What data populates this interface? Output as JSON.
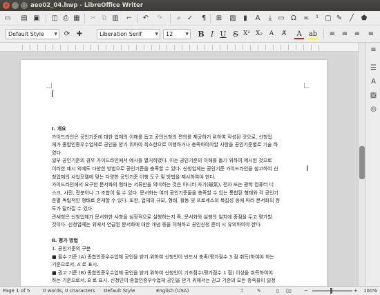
{
  "window": {
    "title": "aeo02_04.hwp - LibreOffice Writer"
  },
  "toolbar": {
    "paragraph_style": "Default Style",
    "font_name": "Liberation Serif",
    "font_size": "12"
  },
  "document": {
    "lines": [
      {
        "text": "Ⅰ. 개요",
        "heading": true
      },
      {
        "text": "  가이드라인은 공인기준에 대한 업체의 이해를 돕고 공인신청의 편의를 제공하기 위하여 작성된 것으로, 신청업",
        "heading": false
      },
      {
        "text": "체가 종합인증우수업체로 공인을 받기 위하여 최소한으로 이행하거나 충족하여야할 사항을 공인기준별로 기술 하",
        "heading": false
      },
      {
        "text": "였다.",
        "heading": false
      },
      {
        "text": "  일부 공인기준의 경우 가이드라인에서 예시를 열거하였다. 이는 공인기준의 이해를 돕기 위하여 제시된 것으로",
        "heading": false
      },
      {
        "text": "이러한 예시 외에도 다양한 방법으로 공인기준을 충족할 수 있다. 신청업체는 공인기준 가이드라인을 참고하여 신",
        "heading": false
      },
      {
        "text": "청업체의 사업모델에 맞는 다양한 공인기준 이행 도구 및 방법을 제시하여야 한다.",
        "heading": false
      },
      {
        "text": "  가이드라인에서 요구한 문서화의 형태는 서류만을 의미하는 것은 아니라 자기(磁氣), 전자 또는 광학 컴퓨터 디",
        "heading": false
      },
      {
        "text": "스크, 사진, 전분이나 그 조합이 될 수 있다. 문서화는 여러 공인기준들을 충족할 수 있는 통합된 형태와 각 공인기",
        "heading": false
      },
      {
        "text": "준별 독립적인 형태로 존재할 수 있다. 또한, 업체의 규모, 형태, 활동 및 프로세스의 복잡성 등에 따라 문서화의 정",
        "heading": false
      },
      {
        "text": "도가 달라질 수 있다.",
        "heading": false
      },
      {
        "text": "  관세청은 신청업체가 문서화한 사항을 심정적으로 실행하는지 즉, 문서화와 실행의 일치에 중점을 두고 평가할",
        "heading": false
      },
      {
        "text": "것이다. 신청업체는 위에서 언급된 문서화에 대한 개념 등을 이해하고 공인신청 준비 시 유의하여야 한다.",
        "heading": false
      },
      {
        "text": "",
        "heading": false
      },
      {
        "text": "Ⅱ. 평가 방법",
        "heading": true
      },
      {
        "text": " 1. 공인기준의 구분",
        "heading": false
      },
      {
        "text": " ■ 필수 기준 (A)    종합인증우수업체 공인을 받기 위하여 신청인이 반드시 충족(평가점수 3 점 취득)하여야 하는",
        "heading": false
      },
      {
        "text": "기준으로서, A 로 표시.",
        "heading": false
      },
      {
        "text": " ■ 권고 기준 (B)    종합인증우수업체 공인을 받기 위하여 신청인이 기초점수(평가점수 1 점) 이상을 취득하여야",
        "heading": false
      },
      {
        "text": "하는 기준으로서, B 로 표시. 신청인이 종합인증우수업체 공인을 받기 위해서는 권고 기준의 모든 충족률이 일정",
        "heading": false
      }
    ]
  },
  "statusbar": {
    "page": "Page 1 of 5",
    "words": "0 words, 0 characters",
    "style": "Default Style",
    "language": "English (USA)",
    "zoom": "100%",
    "zoom_level_percent": 100
  },
  "icons": {
    "toolbar1": [
      "new-document-icon",
      "open-icon",
      "save-icon",
      "export-pdf-icon",
      "print-icon",
      "print-preview-icon",
      "cut-icon",
      "copy-icon",
      "paste-icon",
      "clone-formatting-icon",
      "undo-icon",
      "redo-icon",
      "find-replace-icon",
      "spelling-icon",
      "formatting-marks-icon",
      "table-icon",
      "image-icon",
      "chart-icon",
      "text-box-icon",
      "page-break-icon",
      "field-icon",
      "special-character-icon",
      "hyperlink-icon",
      "footnote-icon",
      "comment-icon",
      "track-changes-icon",
      "line-icon",
      "shapes-icon"
    ],
    "sidebar": [
      "properties-icon",
      "styles-icon",
      "gallery-icon",
      "navigator-icon"
    ]
  }
}
